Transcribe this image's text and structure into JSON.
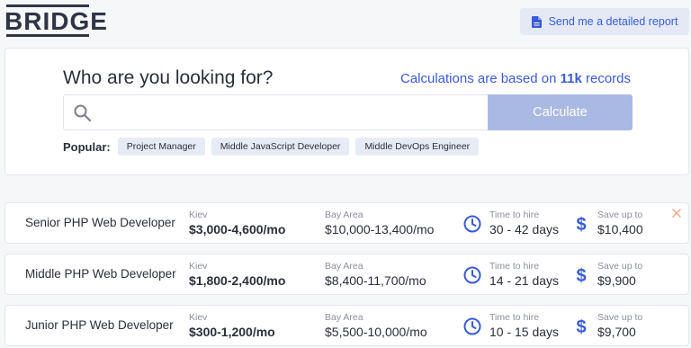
{
  "header": {
    "logo": "BRIDGE",
    "report_button": "Send me a detailed report"
  },
  "search": {
    "title": "Who are you looking for?",
    "note_prefix": "Calculations are based on ",
    "note_count": "11k",
    "note_suffix": " records",
    "input_value": "",
    "input_placeholder": "",
    "calculate_label": "Calculate",
    "popular_label": "Popular:",
    "popular_items": [
      "Project Manager",
      "Middle JavaScript Developer",
      "Middle DevOps Engineer"
    ]
  },
  "results": [
    {
      "title": "Senior PHP Web Developer",
      "kiev_label": "Kiev",
      "kiev_value": "$3,000-4,600/mo",
      "bay_label": "Bay Area",
      "bay_value": "$10,000-13,400/mo",
      "hire_label": "Time to hire",
      "hire_value": "30 - 42 days",
      "save_label": "Save up to",
      "save_value": "$10,400"
    },
    {
      "title": "Middle PHP Web Developer",
      "kiev_label": "Kiev",
      "kiev_value": "$1,800-2,400/mo",
      "bay_label": "Bay Area",
      "bay_value": "$8,400-11,700/mo",
      "hire_label": "Time to hire",
      "hire_value": "14 - 21 days",
      "save_label": "Save up to",
      "save_value": "$9,900"
    },
    {
      "title": "Junior PHP Web Developer",
      "kiev_label": "Kiev",
      "kiev_value": "$300-1,200/mo",
      "bay_label": "Bay Area",
      "bay_value": "$5,500-10,000/mo",
      "hire_label": "Time to hire",
      "hire_value": "10 - 15 days",
      "save_label": "Save up to",
      "save_value": "$9,700"
    }
  ],
  "colors": {
    "accent": "#3a5bd9",
    "button_disabled": "#aab9e3",
    "chip_bg": "#e6ebf5",
    "close": "#f0a08a"
  }
}
